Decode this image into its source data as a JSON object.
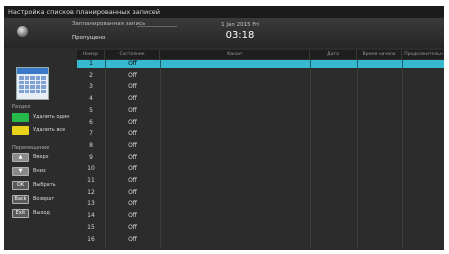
{
  "window": {
    "title": "Настройка списков планированных записей"
  },
  "header": {
    "recording_label": "Запланированная запись",
    "recording_value": "Пропущено",
    "date": "1 Jan 2015 Fri",
    "time": "03:18"
  },
  "sidebar": {
    "section1": "Pаздел",
    "delete_one": {
      "label": "Удалить один",
      "color": "#27b84a"
    },
    "delete_all": {
      "label": "Удалить все",
      "color": "#e8d21a"
    },
    "section2": "Перемещение",
    "up": {
      "key": "▲",
      "label": "Вверх"
    },
    "down": {
      "key": "▼",
      "label": "Вниз"
    },
    "select": {
      "key": "OK",
      "label": "Выбрать"
    },
    "back": {
      "key": "Back",
      "label": "Возврат"
    },
    "exit": {
      "key": "Exit",
      "label": "Выход"
    }
  },
  "table": {
    "headers": {
      "num": "Номер",
      "status": "Состояние",
      "channel": "Канал",
      "date": "Дата",
      "start": "Время начала",
      "duration": "Продолжительн"
    },
    "rows": [
      {
        "num": "1",
        "status": "Off"
      },
      {
        "num": "2",
        "status": "Off"
      },
      {
        "num": "3",
        "status": "Off"
      },
      {
        "num": "4",
        "status": "Off"
      },
      {
        "num": "5",
        "status": "Off"
      },
      {
        "num": "6",
        "status": "Off"
      },
      {
        "num": "7",
        "status": "Off"
      },
      {
        "num": "8",
        "status": "Off"
      },
      {
        "num": "9",
        "status": "Off"
      },
      {
        "num": "10",
        "status": "Off"
      },
      {
        "num": "11",
        "status": "Off"
      },
      {
        "num": "12",
        "status": "Off"
      },
      {
        "num": "13",
        "status": "Off"
      },
      {
        "num": "14",
        "status": "Off"
      },
      {
        "num": "15",
        "status": "Off"
      },
      {
        "num": "16",
        "status": "Off"
      }
    ],
    "selected_index": 0,
    "selected_color": "#36b8cf"
  }
}
